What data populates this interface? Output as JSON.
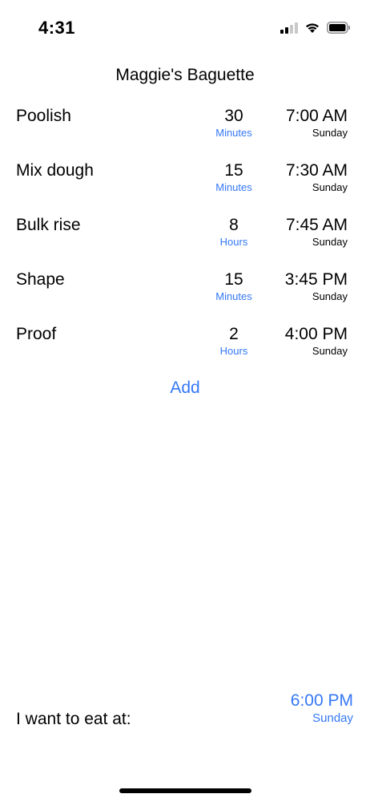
{
  "status_bar": {
    "time": "4:31",
    "icons": [
      "cellular-signal-icon",
      "wifi-icon",
      "battery-icon"
    ]
  },
  "title": "Maggie's Baguette",
  "steps": [
    {
      "name": "Poolish",
      "duration_value": "30",
      "duration_unit": "Minutes",
      "time": "7:00 AM",
      "day": "Sunday"
    },
    {
      "name": "Mix dough",
      "duration_value": "15",
      "duration_unit": "Minutes",
      "time": "7:30 AM",
      "day": "Sunday"
    },
    {
      "name": "Bulk rise",
      "duration_value": "8",
      "duration_unit": "Hours",
      "time": "7:45 AM",
      "day": "Sunday"
    },
    {
      "name": "Shape",
      "duration_value": "15",
      "duration_unit": "Minutes",
      "time": "3:45 PM",
      "day": "Sunday"
    },
    {
      "name": "Proof",
      "duration_value": "2",
      "duration_unit": "Hours",
      "time": "4:00 PM",
      "day": "Sunday"
    }
  ],
  "add_label": "Add",
  "eat": {
    "label": "I want to eat at:",
    "time": "6:00 PM",
    "day": "Sunday"
  },
  "colors": {
    "accent": "#3478f6",
    "text": "#000000",
    "background": "#ffffff"
  }
}
